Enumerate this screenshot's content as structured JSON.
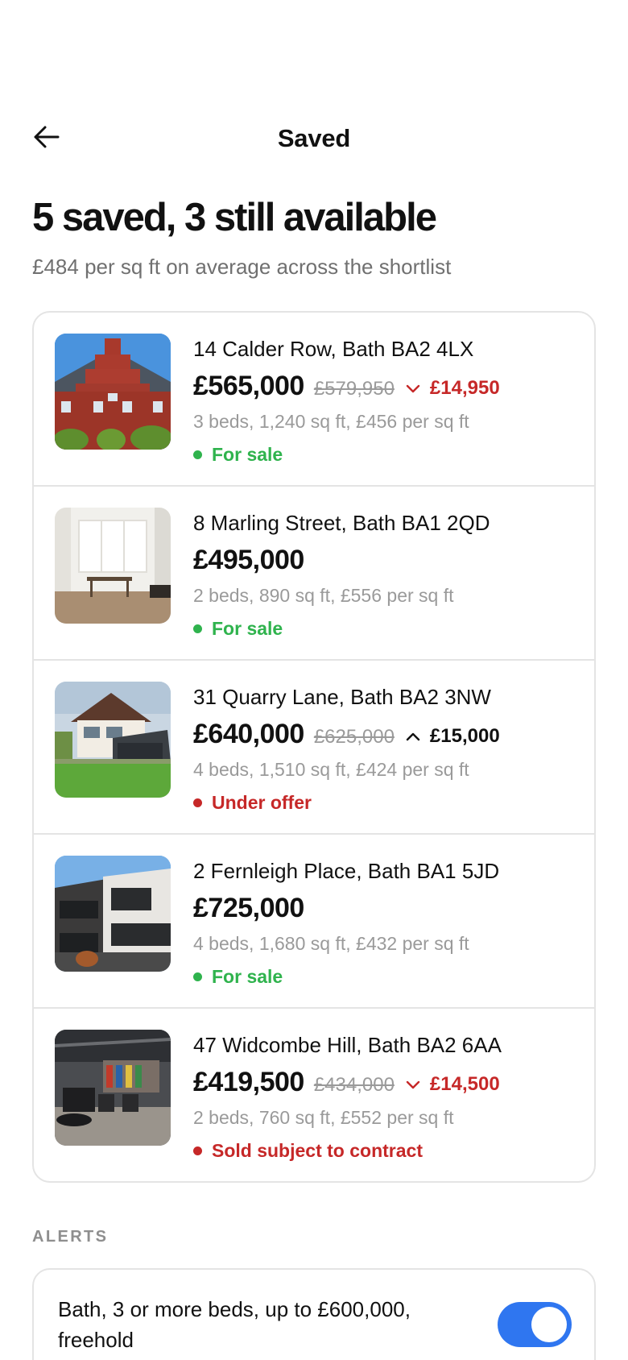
{
  "header": {
    "title": "Saved",
    "back_icon": "arrow-left-icon"
  },
  "summary": {
    "headline": "5 saved, 3 still available",
    "subline": "£484 per sq ft on average across the shortlist"
  },
  "colors": {
    "drop": "#c62828",
    "for_sale": "#2fb34d",
    "under_offer": "#c62828",
    "toggle_on": "#2f76f0"
  },
  "listings": [
    {
      "address": "14 Calder Row, Bath BA2 4LX",
      "price": "£565,000",
      "old_price": "£579,950",
      "change_direction": "down",
      "change": "£14,950",
      "details": "3 beds, 1,240 sq ft, £456 per sq ft",
      "status": "For sale",
      "status_tone": "green",
      "image": "brick-townhouse-photo"
    },
    {
      "address": "8 Marling Street, Bath BA1 2QD",
      "price": "£495,000",
      "old_price": "",
      "change_direction": "",
      "change": "",
      "details": "2 beds, 890 sq ft, £556 per sq ft",
      "status": "For sale",
      "status_tone": "green",
      "image": "bright-interior-photo"
    },
    {
      "address": "31 Quarry Lane, Bath BA2 3NW",
      "price": "£640,000",
      "old_price": "£625,000",
      "change_direction": "up",
      "change": "£15,000",
      "details": "4 beds, 1,510 sq ft, £424 per sq ft",
      "status": "Under offer",
      "status_tone": "red",
      "image": "house-with-lawn-photo"
    },
    {
      "address": "2 Fernleigh Place, Bath BA1 5JD",
      "price": "£725,000",
      "old_price": "",
      "change_direction": "",
      "change": "",
      "details": "4 beds, 1,680 sq ft, £432 per sq ft",
      "status": "For sale",
      "status_tone": "green",
      "image": "modern-house-photo"
    },
    {
      "address": "47 Widcombe Hill, Bath BA2 6AA",
      "price": "£419,500",
      "old_price": "£434,000",
      "change_direction": "down",
      "change": "£14,500",
      "details": "2 beds, 760 sq ft, £552 per sq ft",
      "status": "Sold subject to contract",
      "status_tone": "red",
      "image": "industrial-loft-photo"
    }
  ],
  "alerts": {
    "section_label": "ALERTS",
    "items": [
      {
        "text": "Bath, 3 or more beds, up to £600,000, freehold",
        "enabled": true
      }
    ]
  }
}
